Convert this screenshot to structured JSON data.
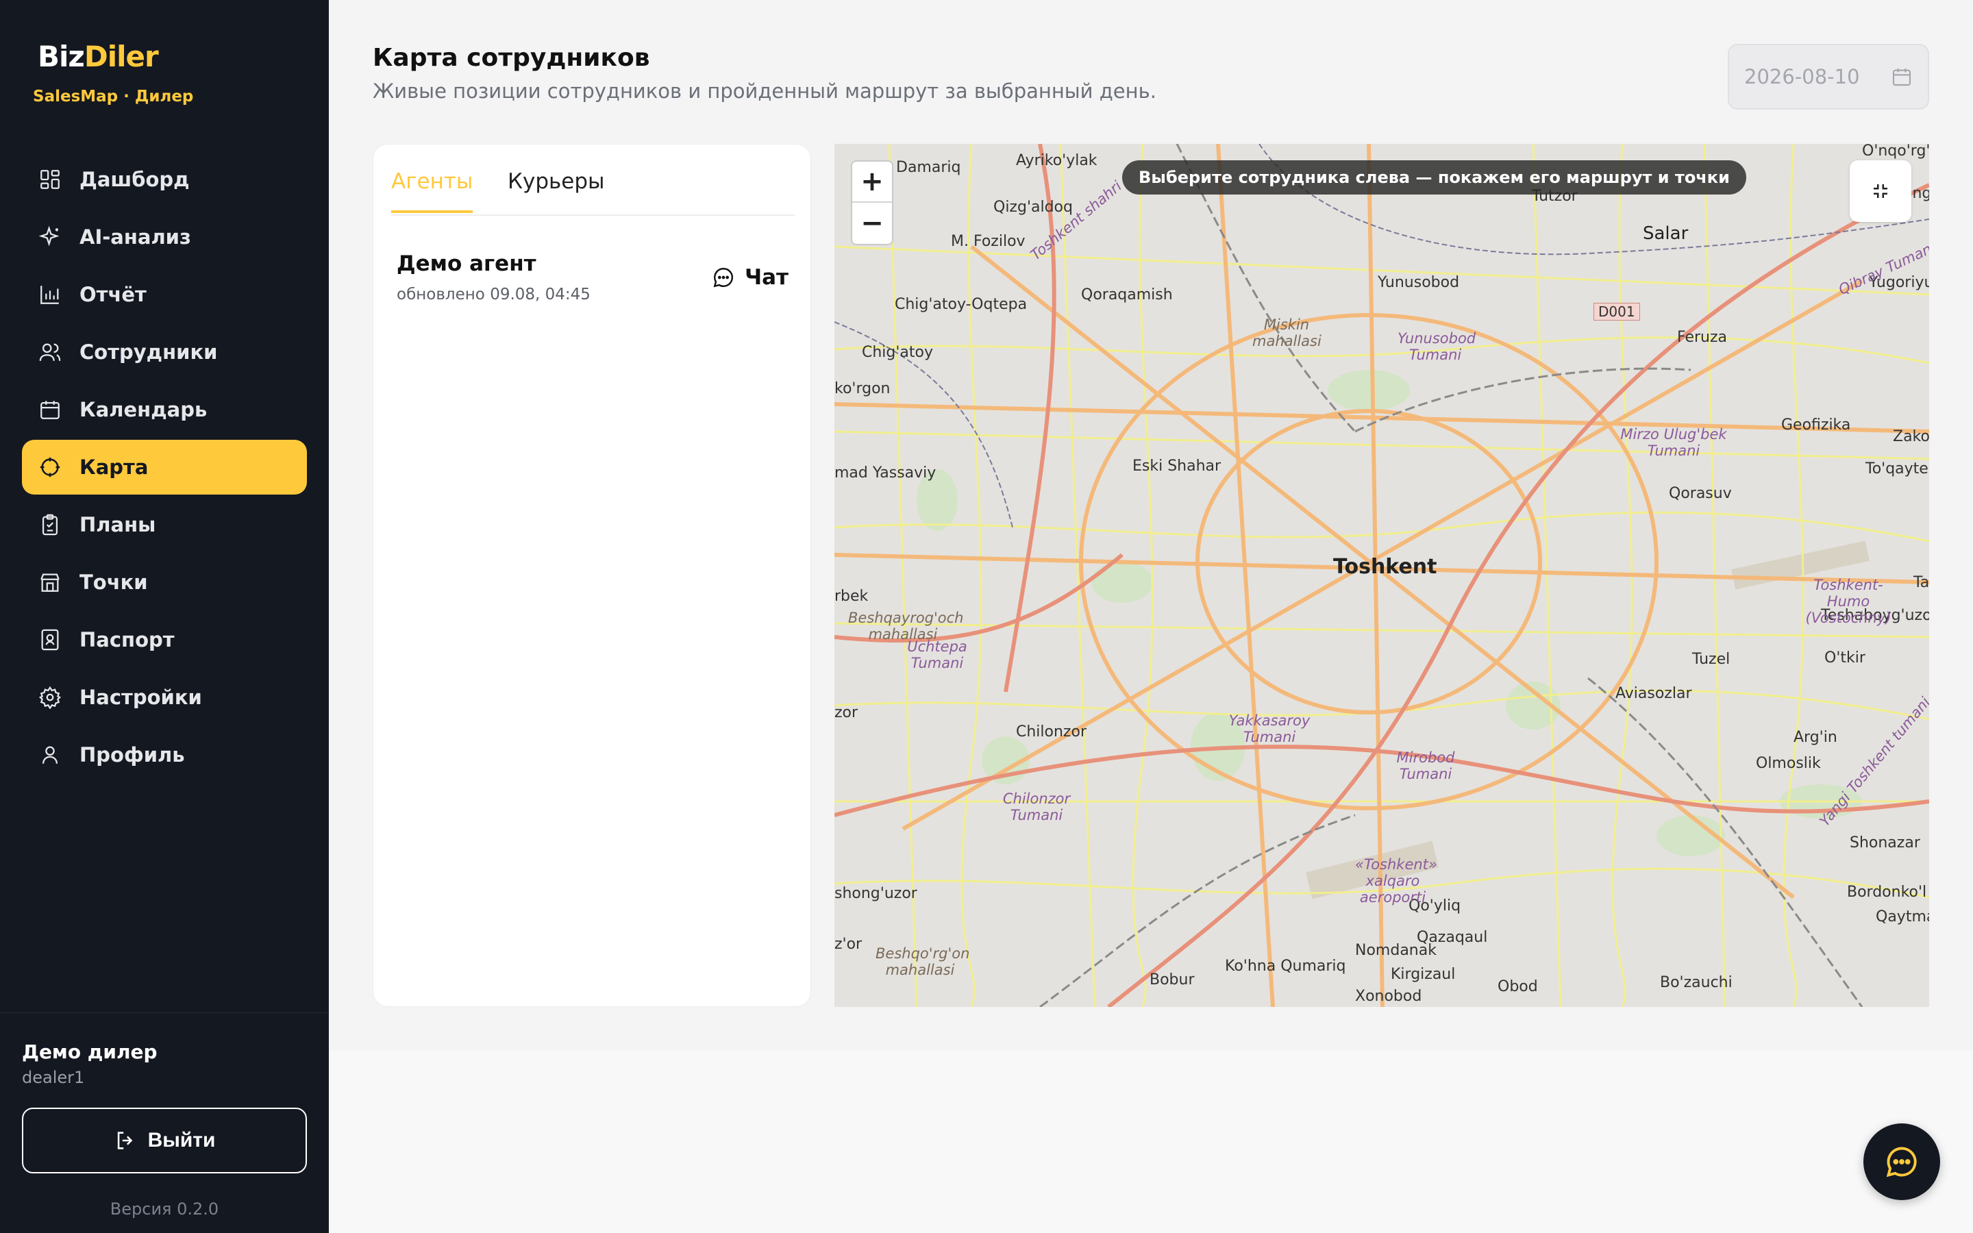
{
  "brand": {
    "part1": "Biz",
    "part2": "Diler",
    "subtitle": "SalesMap · Дилер"
  },
  "nav": [
    {
      "label": "Дашборд",
      "icon": "dashboard-icon"
    },
    {
      "label": "AI-анализ",
      "icon": "sparkle-icon"
    },
    {
      "label": "Отчёт",
      "icon": "bar-chart-icon"
    },
    {
      "label": "Сотрудники",
      "icon": "users-icon"
    },
    {
      "label": "Календарь",
      "icon": "calendar-icon"
    },
    {
      "label": "Карта",
      "icon": "crosshair-icon",
      "active": true
    },
    {
      "label": "Планы",
      "icon": "clipboard-icon"
    },
    {
      "label": "Точки",
      "icon": "store-icon"
    },
    {
      "label": "Паспорт",
      "icon": "id-card-icon"
    },
    {
      "label": "Настройки",
      "icon": "gear-icon"
    },
    {
      "label": "Профиль",
      "icon": "user-icon"
    }
  ],
  "user": {
    "name": "Демо дилер",
    "login": "dealer1"
  },
  "logout_label": "Выйти",
  "version": "Версия 0.2.0",
  "header": {
    "title": "Карта сотрудников",
    "subtitle": "Живые позиции сотрудников и пройденный маршрут за выбранный день.",
    "date": "2026-08-10"
  },
  "tabs": {
    "agents": "Агенты",
    "couriers": "Курьеры",
    "active": "agents"
  },
  "employees": [
    {
      "name": "Демо агент",
      "updated": "обновлено 09.08, 04:45",
      "chat_label": "Чат"
    }
  ],
  "map": {
    "hint": "Выберите сотрудника слева — покажем его маршрут и точки",
    "zoom_in": "+",
    "zoom_out": "−",
    "labels": [
      {
        "text": "Toshkent",
        "big": true
      },
      {
        "text": "Damariq"
      },
      {
        "text": "Ayriko'ylak"
      },
      {
        "text": "O'nqo'rg'on"
      },
      {
        "text": "Qizg'aldoq"
      },
      {
        "text": "M. Fozilov"
      },
      {
        "text": "Tutzor"
      },
      {
        "text": "Salar"
      },
      {
        "text": "Yalang"
      },
      {
        "text": "Yunusobod"
      },
      {
        "text": "Yugoriyuz"
      },
      {
        "text": "Chig'atoy-Oqtepa"
      },
      {
        "text": "Qoraqamish"
      },
      {
        "text": "Feruza"
      },
      {
        "text": "Chig'atoy"
      },
      {
        "text": "ko'rgon"
      },
      {
        "text": "Geofizika"
      },
      {
        "text": "Zakova"
      },
      {
        "text": "mad Yassaviy"
      },
      {
        "text": "Eski Shahar"
      },
      {
        "text": "To'qaytepa"
      },
      {
        "text": "Qorasuv"
      },
      {
        "text": "Tas"
      },
      {
        "text": "rbek"
      },
      {
        "text": "Teshaboyg'uzor"
      },
      {
        "text": "Tuzel"
      },
      {
        "text": "O'tkir"
      },
      {
        "text": "Aviasozlar"
      },
      {
        "text": "zor"
      },
      {
        "text": "Chilonzor"
      },
      {
        "text": "Arg'in"
      },
      {
        "text": "Olmoslik"
      },
      {
        "text": "Shonazar"
      },
      {
        "text": "shong'uzor"
      },
      {
        "text": "Bordonko'l"
      },
      {
        "text": "Qo'yliq"
      },
      {
        "text": "Qaytmas"
      },
      {
        "text": "Qazaqaul"
      },
      {
        "text": "Nomdanak"
      },
      {
        "text": "z'or"
      },
      {
        "text": "Ko'hna Qumariq"
      },
      {
        "text": "Kirgizaul"
      },
      {
        "text": "Bobur"
      },
      {
        "text": "Obod"
      },
      {
        "text": "Bo'zauchi"
      },
      {
        "text": "Xonobod"
      },
      {
        "text": "D001"
      }
    ],
    "districts": [
      {
        "text": "Yunusobod Tumani"
      },
      {
        "text": "Miskin mahallasi"
      },
      {
        "text": "Mirzo Ulug'bek Tumani"
      },
      {
        "text": "Toshkent-Humo (Vostochny)"
      },
      {
        "text": "Beshqayrog'och mahallasi"
      },
      {
        "text": "Uchtepa Tumani"
      },
      {
        "text": "Yakkasaroy Tumani"
      },
      {
        "text": "Mirobod Tumani"
      },
      {
        "text": "Chilonzor Tumani"
      },
      {
        "text": "«Toshkent» xalqaro aeroporti"
      },
      {
        "text": "Beshqo'rg'on mahallasi"
      },
      {
        "text": "Toshkent shahri"
      },
      {
        "text": "Qibray Tumani"
      },
      {
        "text": "Yangi Toshkent tumani"
      }
    ]
  },
  "colors": {
    "accent": "#ffc93c",
    "sidebar": "#141821"
  }
}
